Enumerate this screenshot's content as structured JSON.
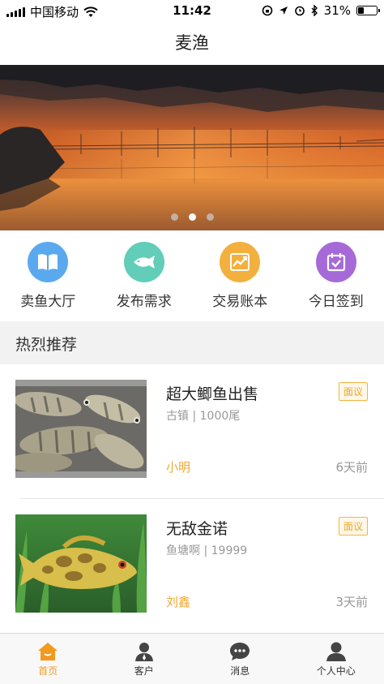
{
  "status_bar": {
    "carrier": "中国移动",
    "time": "11:42",
    "battery": "31%",
    "battery_level": 0.31
  },
  "nav": {
    "title": "麦渔"
  },
  "banner": {
    "slide_count": 3,
    "active_index": 1
  },
  "quick_menu": [
    {
      "label": "卖鱼大厅",
      "icon": "book-icon",
      "color": "#5aa9ee"
    },
    {
      "label": "发布需求",
      "icon": "fish-icon",
      "color": "#62cdb9"
    },
    {
      "label": "交易账本",
      "icon": "chart-icon",
      "color": "#f3b03e"
    },
    {
      "label": "今日签到",
      "icon": "calendar-check-icon",
      "color": "#a66ad8"
    }
  ],
  "section": {
    "title": "热烈推荐"
  },
  "listings": [
    {
      "title": "超大鲫鱼出售",
      "location": "古镇",
      "quantity": "1000尾",
      "badge": "面议",
      "user": "小明",
      "time": "6天前"
    },
    {
      "title": "无敌金诺",
      "location": "鱼塘啊",
      "quantity": "19999",
      "badge": "面议",
      "user": "刘鑫",
      "time": "3天前"
    }
  ],
  "tabs": [
    {
      "label": "首页",
      "icon": "home-icon",
      "active": true
    },
    {
      "label": "客户",
      "icon": "customer-icon",
      "active": false
    },
    {
      "label": "消息",
      "icon": "message-icon",
      "active": false
    },
    {
      "label": "个人中心",
      "icon": "profile-icon",
      "active": false
    }
  ],
  "colors": {
    "accent": "#f19a1d",
    "badge": "#e9a72f",
    "user": "#f1a730"
  }
}
